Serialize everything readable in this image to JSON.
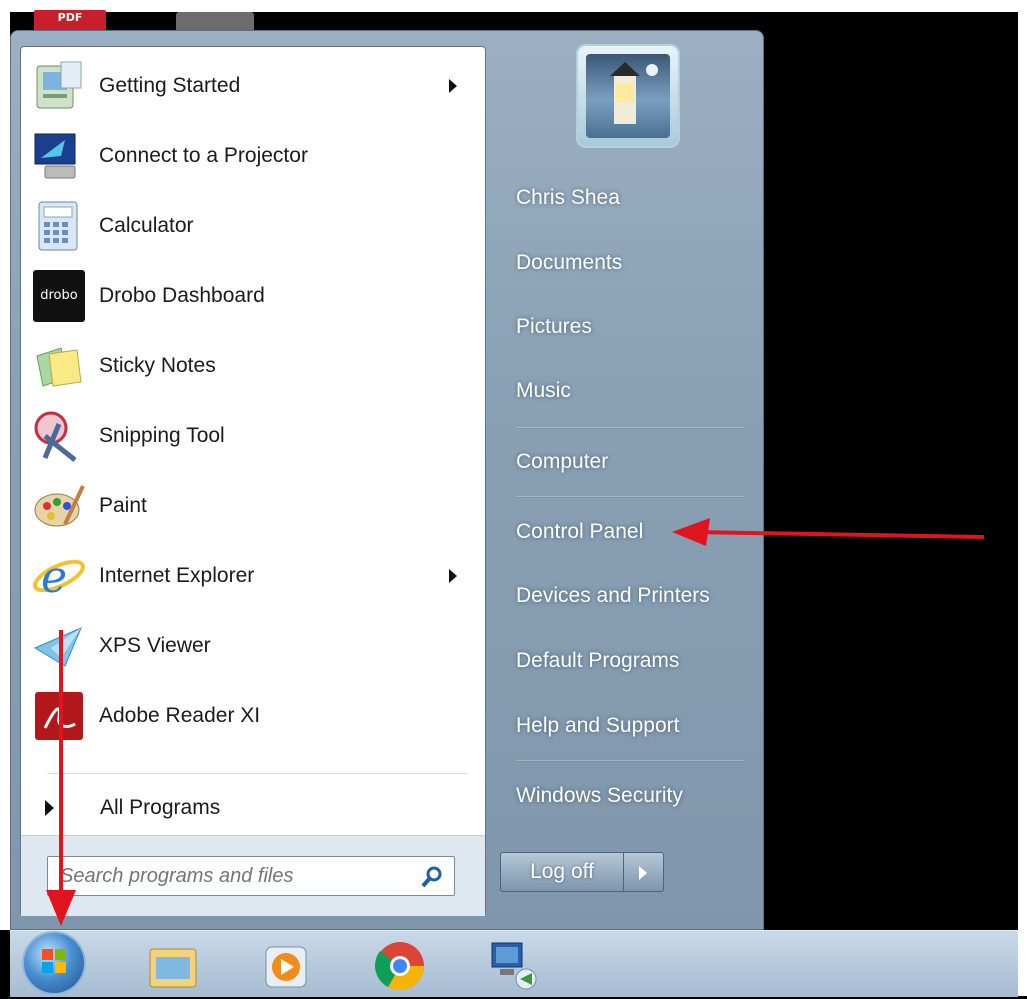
{
  "desktop": {
    "pdf_icon_label": "PDF"
  },
  "programs": [
    {
      "label": "Getting Started",
      "icon": "getting-started-icon",
      "submenu": true
    },
    {
      "label": "Connect to a Projector",
      "icon": "projector-icon",
      "submenu": false
    },
    {
      "label": "Calculator",
      "icon": "calculator-icon",
      "submenu": false
    },
    {
      "label": "Drobo Dashboard",
      "icon": "drobo-icon",
      "submenu": false
    },
    {
      "label": "Sticky Notes",
      "icon": "sticky-notes-icon",
      "submenu": false
    },
    {
      "label": "Snipping Tool",
      "icon": "snipping-tool-icon",
      "submenu": false
    },
    {
      "label": "Paint",
      "icon": "paint-icon",
      "submenu": false
    },
    {
      "label": "Internet Explorer",
      "icon": "internet-explorer-icon",
      "submenu": true
    },
    {
      "label": "XPS Viewer",
      "icon": "xps-viewer-icon",
      "submenu": false
    },
    {
      "label": "Adobe Reader XI",
      "icon": "adobe-reader-icon",
      "submenu": false
    }
  ],
  "drobo_icon_text": "drobo",
  "all_programs": "All Programs",
  "search": {
    "placeholder": "Search programs and files"
  },
  "right_links": [
    {
      "label": "Chris Shea"
    },
    {
      "label": "Documents"
    },
    {
      "label": "Pictures"
    },
    {
      "label": "Music"
    },
    {
      "label": "Computer"
    },
    {
      "label": "Control Panel"
    },
    {
      "label": "Devices and Printers"
    },
    {
      "label": "Default Programs"
    },
    {
      "label": "Help and Support"
    },
    {
      "label": "Windows Security"
    }
  ],
  "logoff": {
    "label": "Log off"
  },
  "taskbar": {
    "items": [
      "windows-start-orb",
      "file-explorer-icon",
      "media-player-icon",
      "chrome-icon",
      "remote-desktop-icon"
    ]
  },
  "colors": {
    "annotation_arrow": "#e0141e",
    "menu_pane": "#8aa0b4"
  }
}
